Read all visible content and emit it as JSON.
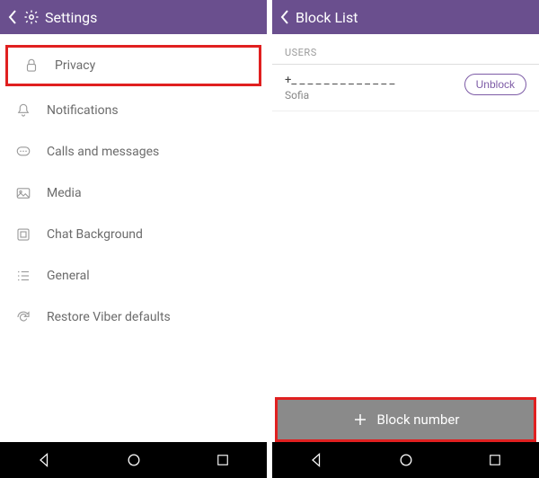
{
  "left": {
    "header": {
      "title": "Settings"
    },
    "menu": {
      "privacy": "Privacy",
      "notifications": "Notifications",
      "calls": "Calls and messages",
      "media": "Media",
      "background": "Chat Background",
      "general": "General",
      "restore": "Restore Viber defaults"
    }
  },
  "right": {
    "header": {
      "title": "Block List"
    },
    "section": "USERS",
    "user": {
      "number": "+_ _ _ _ _ _ _ _ _ _ _ _ _",
      "name": "Sofia"
    },
    "unblock": "Unblock",
    "block_number": "Block number"
  },
  "colors": {
    "brand": "#6A4F8E",
    "highlight": "#E02020"
  }
}
